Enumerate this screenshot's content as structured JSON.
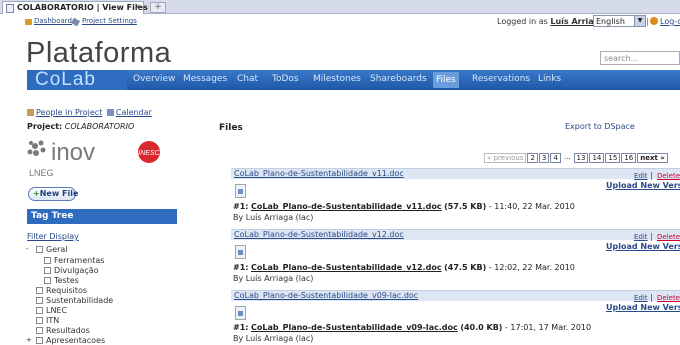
{
  "browser": {
    "tab_title": "COLABORATORIO | View Files",
    "tab_close": "x",
    "new_tab": "+"
  },
  "topbar": {
    "dashboard": "Dashboard",
    "project_settings": "Project Settings",
    "login_prefix": "Logged in as",
    "user": "Luís Arriaga",
    "language": "English",
    "logout": "Log-out"
  },
  "brand": "Plataforma",
  "search": {
    "placeholder": "search..."
  },
  "nav": {
    "logo": "CoLab",
    "items": [
      "Overview",
      "Messages",
      "Chat",
      "ToDos",
      "Milestones",
      "Shareboards",
      "Files",
      "Reservations",
      "Links"
    ],
    "active": "Files"
  },
  "sidebar": {
    "people": "People in Project",
    "calendar": "Calendar",
    "project_label": "Project:",
    "project_name": "COLABORATORIO",
    "logo_text": "inov",
    "logo_badge": "INESC",
    "logo_sub": "LNEG",
    "new_file": "New File",
    "tag_tree": "Tag Tree",
    "filter_display": "Filter Display",
    "tree": [
      {
        "label": "Geral",
        "level": 0,
        "expander": "-"
      },
      {
        "label": "Ferramentas",
        "level": 1
      },
      {
        "label": "Divulgação",
        "level": 1
      },
      {
        "label": "Testes",
        "level": 1
      },
      {
        "label": "Requisitos",
        "level": 0
      },
      {
        "label": "Sustentabilidade",
        "level": 0
      },
      {
        "label": "LNEC",
        "level": 0
      },
      {
        "label": "ITN",
        "level": 0
      },
      {
        "label": "Resultados",
        "level": 0
      },
      {
        "label": "Apresentacoes",
        "level": 0,
        "expander": "+"
      }
    ]
  },
  "main": {
    "title": "Files",
    "export": "Export to DSpace",
    "pager": {
      "previous": "« previous",
      "pages_a": [
        "2",
        "3",
        "4"
      ],
      "dots": "...",
      "pages_b": [
        "13",
        "14",
        "15",
        "16"
      ],
      "next": "next »"
    },
    "files": [
      {
        "name": "CoLab_Plano-de-Sustentabilidade_v11.doc",
        "version": "#1:",
        "size": "(57.5 KB)",
        "date": "- 11:40, 22 Mar. 2010",
        "by": "By Luís Arriaga (lac)"
      },
      {
        "name": "CoLab_Plano-de-Sustentabilidade_v12.doc",
        "version": "#1:",
        "size": "(47.5 KB)",
        "date": "- 12:02, 22 Mar. 2010",
        "by": "By Luís Arriaga (lac)"
      },
      {
        "name": "CoLab_Plano-de-Sustentabilidade_v09-lac.doc",
        "version": "#1:",
        "size": "(40.0 KB)",
        "date": "- 17:01, 17 Mar. 2010",
        "by": "By Luís Arriaga (lac)"
      }
    ],
    "edit": "Edit",
    "delete": "Delete",
    "pipe": "|",
    "upload": "Upload New Version"
  },
  "colors": {
    "nav_blue": "#1f58a8",
    "header_bar": "#dde6f2",
    "delete_red": "#cc0033"
  }
}
